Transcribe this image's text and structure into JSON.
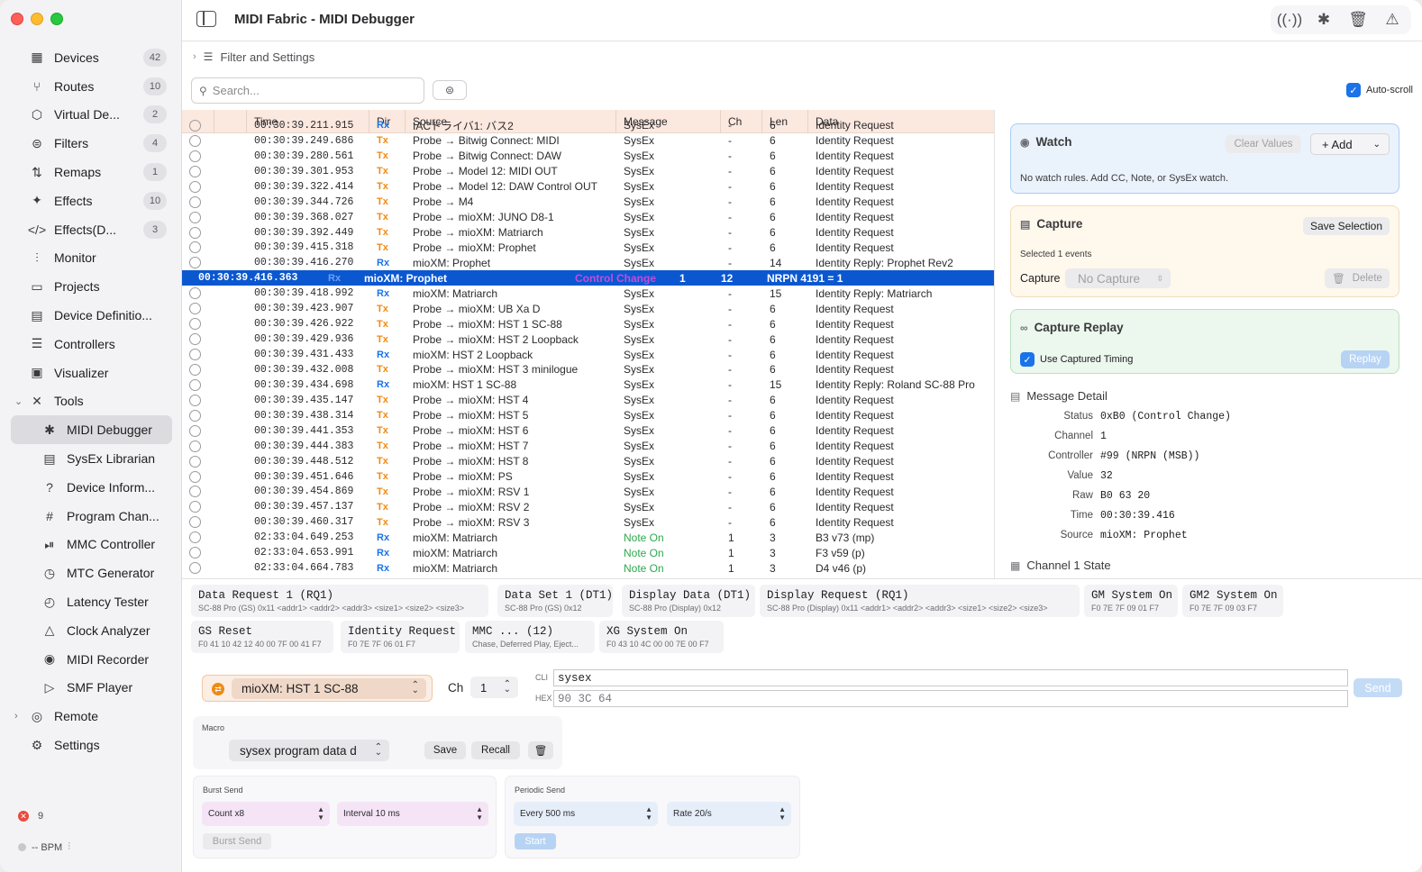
{
  "window": {
    "title": "MIDI Fabric - MIDI Debugger"
  },
  "sidebar": {
    "items": [
      {
        "label": "Devices",
        "badge": "42",
        "icon": "piano-keys-icon",
        "glyph": "▦"
      },
      {
        "label": "Routes",
        "badge": "10",
        "icon": "route-fork-icon",
        "glyph": "⑂"
      },
      {
        "label": "Virtual De...",
        "badge": "2",
        "icon": "cube-icon",
        "glyph": "⬡"
      },
      {
        "label": "Filters",
        "badge": "4",
        "icon": "filter-icon",
        "glyph": "⊜"
      },
      {
        "label": "Remaps",
        "badge": "1",
        "icon": "remap-icon",
        "glyph": "⇅"
      },
      {
        "label": "Effects",
        "badge": "10",
        "icon": "wand-icon",
        "glyph": "✦"
      },
      {
        "label": "Effects(D...",
        "badge": "3",
        "icon": "code-icon",
        "glyph": "</>"
      },
      {
        "label": "Monitor",
        "badge": "",
        "icon": "waveform-icon",
        "glyph": "⫶"
      },
      {
        "label": "Projects",
        "badge": "",
        "icon": "folder-icon",
        "glyph": "▭"
      },
      {
        "label": "Device Definitio...",
        "badge": "",
        "icon": "document-icon",
        "glyph": "▤"
      },
      {
        "label": "Controllers",
        "badge": "",
        "icon": "sliders-icon",
        "glyph": "☰"
      },
      {
        "label": "Visualizer",
        "badge": "",
        "icon": "visualizer-icon",
        "glyph": "▣"
      }
    ],
    "tools_label": "Tools",
    "tools": [
      {
        "label": "MIDI Debugger",
        "icon": "ladybug-icon",
        "glyph": "✱"
      },
      {
        "label": "SysEx Librarian",
        "icon": "archive-icon",
        "glyph": "▤"
      },
      {
        "label": "Device Inform...",
        "icon": "question-icon",
        "glyph": "?"
      },
      {
        "label": "Program Chan...",
        "icon": "number-icon",
        "glyph": "#"
      },
      {
        "label": "MMC Controller",
        "icon": "transport-icon",
        "glyph": "⏯"
      },
      {
        "label": "MTC Generator",
        "icon": "clock-icon",
        "glyph": "◷"
      },
      {
        "label": "Latency Tester",
        "icon": "stopwatch-icon",
        "glyph": "◴"
      },
      {
        "label": "Clock Analyzer",
        "icon": "metronome-icon",
        "glyph": "△"
      },
      {
        "label": "MIDI Recorder",
        "icon": "record-icon",
        "glyph": "◉"
      },
      {
        "label": "SMF Player",
        "icon": "play-icon",
        "glyph": "▷"
      }
    ],
    "remote_label": "Remote",
    "settings_label": "Settings",
    "error_count": "9",
    "bpm_text": "-- BPM"
  },
  "toolbar": {
    "filter_settings": "Filter and Settings",
    "search_placeholder": "Search...",
    "autoscroll_label": "Auto-scroll"
  },
  "table": {
    "headers": [
      "Time",
      "Dir",
      "Source",
      "Message",
      "Ch",
      "Len",
      "Data"
    ],
    "rows": [
      [
        "00:30:39.211.915",
        "Rx",
        "IACドライバ1: バス2",
        "SysEx",
        "-",
        "6",
        "Identity Request"
      ],
      [
        "00:30:39.249.686",
        "Tx",
        "Probe → Bitwig Connect: MIDI",
        "SysEx",
        "-",
        "6",
        "Identity Request"
      ],
      [
        "00:30:39.280.561",
        "Tx",
        "Probe → Bitwig Connect: DAW",
        "SysEx",
        "-",
        "6",
        "Identity Request"
      ],
      [
        "00:30:39.301.953",
        "Tx",
        "Probe → Model 12: MIDI OUT",
        "SysEx",
        "-",
        "6",
        "Identity Request"
      ],
      [
        "00:30:39.322.414",
        "Tx",
        "Probe → Model 12: DAW Control OUT",
        "SysEx",
        "-",
        "6",
        "Identity Request"
      ],
      [
        "00:30:39.344.726",
        "Tx",
        "Probe → M4",
        "SysEx",
        "-",
        "6",
        "Identity Request"
      ],
      [
        "00:30:39.368.027",
        "Tx",
        "Probe → mioXM: JUNO D8-1",
        "SysEx",
        "-",
        "6",
        "Identity Request"
      ],
      [
        "00:30:39.392.449",
        "Tx",
        "Probe → mioXM: Matriarch",
        "SysEx",
        "-",
        "6",
        "Identity Request"
      ],
      [
        "00:30:39.415.318",
        "Tx",
        "Probe → mioXM: Prophet",
        "SysEx",
        "-",
        "6",
        "Identity Request"
      ],
      [
        "00:30:39.416.270",
        "Rx",
        "mioXM: Prophet",
        "SysEx",
        "-",
        "14",
        "Identity Reply: Prophet Rev2"
      ],
      [
        "00:30:39.416.363",
        "Rx",
        "mioXM: Prophet",
        "Control Change",
        "1",
        "12",
        "NRPN 4191 = 1"
      ],
      [
        "00:30:39.418.992",
        "Rx",
        "mioXM: Matriarch",
        "SysEx",
        "-",
        "15",
        "Identity Reply: Matriarch"
      ],
      [
        "00:30:39.423.907",
        "Tx",
        "Probe → mioXM: UB Xa D",
        "SysEx",
        "-",
        "6",
        "Identity Request"
      ],
      [
        "00:30:39.426.922",
        "Tx",
        "Probe → mioXM: HST 1 SC-88",
        "SysEx",
        "-",
        "6",
        "Identity Request"
      ],
      [
        "00:30:39.429.936",
        "Tx",
        "Probe → mioXM: HST 2 Loopback",
        "SysEx",
        "-",
        "6",
        "Identity Request"
      ],
      [
        "00:30:39.431.433",
        "Rx",
        "mioXM: HST 2 Loopback",
        "SysEx",
        "-",
        "6",
        "Identity Request"
      ],
      [
        "00:30:39.432.008",
        "Tx",
        "Probe → mioXM: HST 3 minilogue",
        "SysEx",
        "-",
        "6",
        "Identity Request"
      ],
      [
        "00:30:39.434.698",
        "Rx",
        "mioXM: HST 1 SC-88",
        "SysEx",
        "-",
        "15",
        "Identity Reply: Roland SC-88 Pro"
      ],
      [
        "00:30:39.435.147",
        "Tx",
        "Probe → mioXM: HST 4",
        "SysEx",
        "-",
        "6",
        "Identity Request"
      ],
      [
        "00:30:39.438.314",
        "Tx",
        "Probe → mioXM: HST 5",
        "SysEx",
        "-",
        "6",
        "Identity Request"
      ],
      [
        "00:30:39.441.353",
        "Tx",
        "Probe → mioXM: HST 6",
        "SysEx",
        "-",
        "6",
        "Identity Request"
      ],
      [
        "00:30:39.444.383",
        "Tx",
        "Probe → mioXM: HST 7",
        "SysEx",
        "-",
        "6",
        "Identity Request"
      ],
      [
        "00:30:39.448.512",
        "Tx",
        "Probe → mioXM: HST 8",
        "SysEx",
        "-",
        "6",
        "Identity Request"
      ],
      [
        "00:30:39.451.646",
        "Tx",
        "Probe → mioXM: PS",
        "SysEx",
        "-",
        "6",
        "Identity Request"
      ],
      [
        "00:30:39.454.869",
        "Tx",
        "Probe → mioXM: RSV 1",
        "SysEx",
        "-",
        "6",
        "Identity Request"
      ],
      [
        "00:30:39.457.137",
        "Tx",
        "Probe → mioXM: RSV 2",
        "SysEx",
        "-",
        "6",
        "Identity Request"
      ],
      [
        "00:30:39.460.317",
        "Tx",
        "Probe → mioXM: RSV 3",
        "SysEx",
        "-",
        "6",
        "Identity Request"
      ],
      [
        "02:33:04.649.253",
        "Rx",
        "mioXM: Matriarch",
        "Note On",
        "1",
        "3",
        "B3 v73 (mp)"
      ],
      [
        "02:33:04.653.991",
        "Rx",
        "mioXM: Matriarch",
        "Note On",
        "1",
        "3",
        "F3 v59 (p)"
      ],
      [
        "02:33:04.664.783",
        "Rx",
        "mioXM: Matriarch",
        "Note On",
        "1",
        "3",
        "D4 v46 (p)"
      ]
    ],
    "selected_index": 10
  },
  "watch": {
    "title": "Watch",
    "clear_label": "Clear Values",
    "add_label": "+ Add",
    "empty_text": "No watch rules. Add CC, Note, or SysEx watch."
  },
  "capture": {
    "title": "Capture",
    "save_label": "Save Selection",
    "selected_text": "Selected 1 events",
    "capture_label": "Capture",
    "select_value": "No Capture",
    "delete_label": "Delete"
  },
  "replay": {
    "title": "Capture Replay",
    "timing_label": "Use Captured Timing",
    "replay_label": "Replay"
  },
  "detail": {
    "title": "Message Detail",
    "fields": [
      {
        "k": "Status",
        "v": "0xB0 (Control Change)"
      },
      {
        "k": "Channel",
        "v": "1"
      },
      {
        "k": "Controller",
        "v": "#99 (NRPN (MSB))"
      },
      {
        "k": "Value",
        "v": "32"
      },
      {
        "k": "Raw",
        "v": "B0 63 20"
      },
      {
        "k": "Time",
        "v": "00:30:39.416"
      },
      {
        "k": "Source",
        "v": "mioXM: Prophet"
      }
    ],
    "channel_state": "Channel 1 State"
  },
  "presets": [
    {
      "t": "Data Request 1 (RQ1)",
      "s": "SC-88 Pro (GS) 0x11 <addr1> <addr2> <addr3> <size1> <size2> <size3>"
    },
    {
      "t": "Data Set 1 (DT1)",
      "s": "SC-88 Pro (GS) 0x12"
    },
    {
      "t": "Display Data (DT1)",
      "s": "SC-88 Pro (Display) 0x12"
    },
    {
      "t": "Display Request (RQ1)",
      "s": "SC-88 Pro (Display) 0x11 <addr1> <addr2> <addr3> <size1> <size2> <size3>"
    },
    {
      "t": "GM System On",
      "s": "F0 7E 7F 09 01 F7"
    },
    {
      "t": "GM2 System On",
      "s": "F0 7E 7F 09 03 F7"
    },
    {
      "t": "GS Reset",
      "s": "F0 41 10 42 12 40 00 7F 00 41 F7"
    },
    {
      "t": "Identity Request",
      "s": "F0 7E 7F 06 01 F7"
    },
    {
      "t": "MMC ... (12)",
      "s": "Chase, Deferred Play, Eject..."
    },
    {
      "t": "XG System On",
      "s": "F0 43 10 4C 00 00 7E 00 F7"
    }
  ],
  "sender": {
    "port": "mioXM: HST 1 SC-88",
    "ch_label": "Ch",
    "ch_value": "1",
    "cli_label": "CLI",
    "cli_value": "sysex",
    "hex_label": "HEX",
    "hex_value": "90 3C 64",
    "send_label": "Send"
  },
  "macro": {
    "label": "Macro",
    "select_value": "sysex program data d",
    "save_label": "Save",
    "recall_label": "Recall"
  },
  "burst": {
    "label": "Burst Send",
    "count": "Count x8",
    "interval": "Interval 10 ms",
    "button": "Burst Send"
  },
  "periodic": {
    "label": "Periodic Send",
    "every": "Every 500 ms",
    "rate": "Rate 20/s",
    "button": "Start"
  },
  "colors": {
    "accent": "#0b57d0",
    "tx": "#f08a12",
    "rx": "#1a73e8",
    "note_on": "#2fa84f",
    "control_change": "#c64bd9"
  }
}
